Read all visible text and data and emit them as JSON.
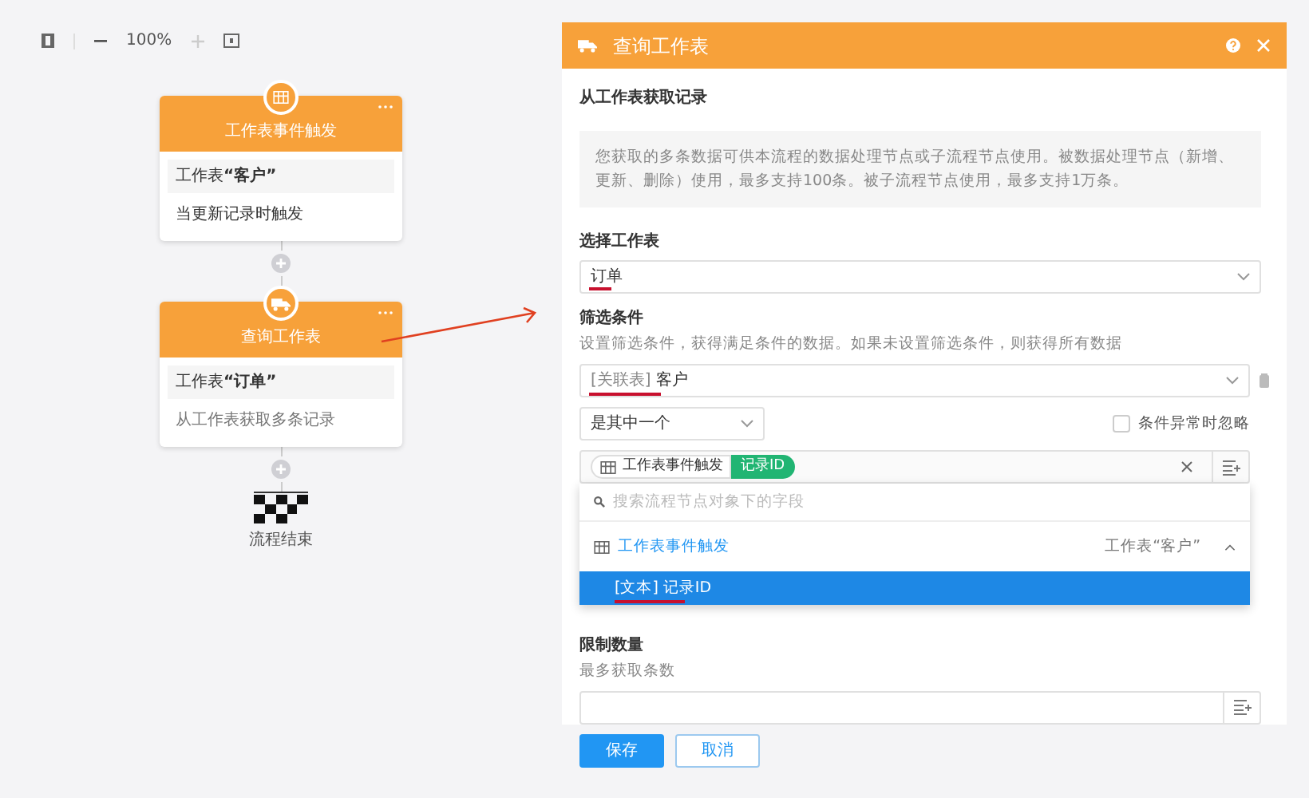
{
  "toolbar": {
    "zoom": "100%"
  },
  "nodes": [
    {
      "kind": "trigger",
      "title": "工作表事件触发",
      "sheet": "工作表**“客户”**",
      "description": "当更新记录时触发"
    },
    {
      "kind": "query",
      "title": "查询工作表",
      "sheet": "工作表**“订单”**",
      "description": "从工作表获取多条记录"
    }
  ],
  "end_node": {
    "label": "流程结束"
  },
  "panel": {
    "title": "查询工作表",
    "section_title": "从工作表获取记录",
    "notice": "您获取的多条数据可供本流程的数据处理节点或子流程节点使用。被数据处理节点（新增、更新、删除）使用，最多支持100条。被子流程节点使用，最多支持1万条。",
    "sheet_select": {
      "label": "选择工作表",
      "value": "订单"
    },
    "filter": {
      "label": "筛选条件",
      "hint": "设置筛选条件，获得满足条件的数据。如果未设置筛选条件，则获得所有数据",
      "field": {
        "tag": "[关联表]",
        "value": "客户"
      },
      "operator": "是其中一个",
      "ignore_error": {
        "label": "条件异常时忽略",
        "checked": false
      },
      "token": {
        "node": "工作表事件触发",
        "field": "记录ID"
      },
      "dropdown": {
        "placeholder": "搜索流程节点对象下的字段",
        "group": {
          "label": "工作表事件触发",
          "note": "工作表“客户”",
          "expanded": true
        },
        "options": [
          {
            "tag": "[文本]",
            "label": "记录ID",
            "selected": true
          }
        ]
      }
    },
    "limit": {
      "label": "限制数量",
      "hint": "最多获取条数"
    },
    "buttons": [
      {
        "label": "保存",
        "kind": "primary"
      },
      {
        "label": "取消",
        "kind": "secondary"
      }
    ]
  }
}
